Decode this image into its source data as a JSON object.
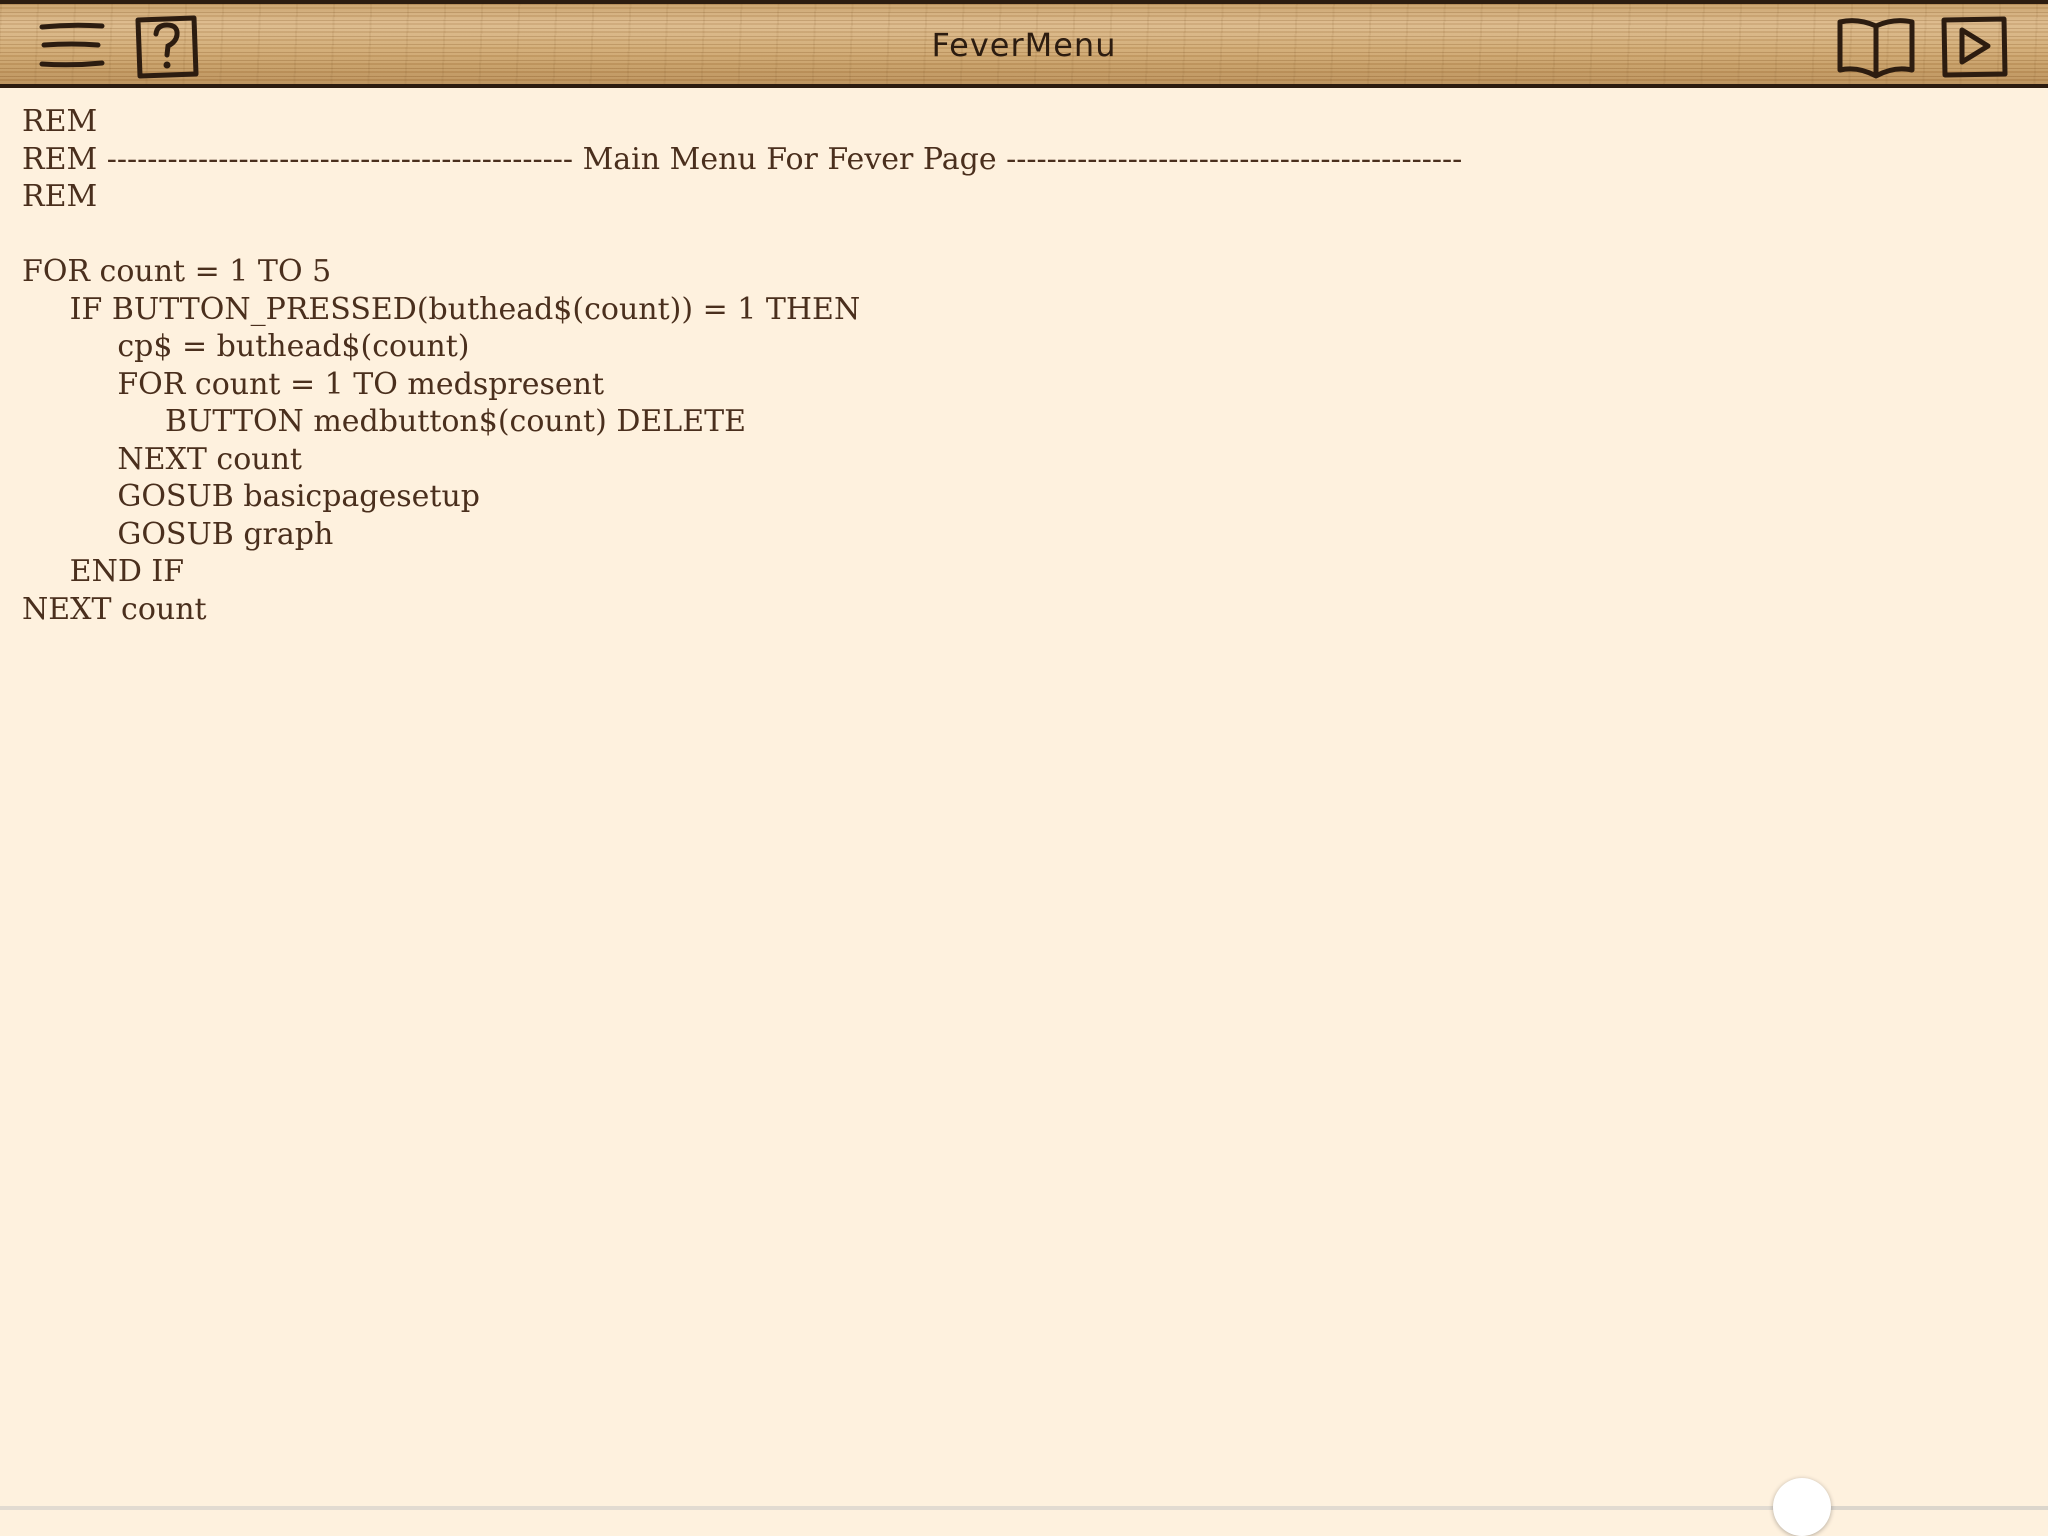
{
  "header": {
    "title": "FeverMenu",
    "left_icons": [
      "menu-icon",
      "help-icon"
    ],
    "right_icons": [
      "book-icon",
      "play-icon"
    ]
  },
  "code": {
    "lines": [
      "REM",
      "REM ---------------------------------------------- Main Menu For Fever Page ---------------------------------------------",
      "REM",
      "",
      "FOR count = 1 TO 5",
      "     IF BUTTON_PRESSED(buthead$(count)) = 1 THEN",
      "          cp$ = buthead$(count)",
      "          FOR count = 1 TO medspresent",
      "               BUTTON medbutton$(count) DELETE",
      "          NEXT count",
      "          GOSUB basicpagesetup",
      "          GOSUB graph",
      "     END IF",
      "NEXT count"
    ]
  },
  "scrubber": {
    "position": 0.88
  },
  "colors": {
    "background": "#fef1de",
    "text": "#4a2f1d",
    "toolbar_wood": "#d1aa74",
    "toolbar_ink": "#2c1c10"
  }
}
